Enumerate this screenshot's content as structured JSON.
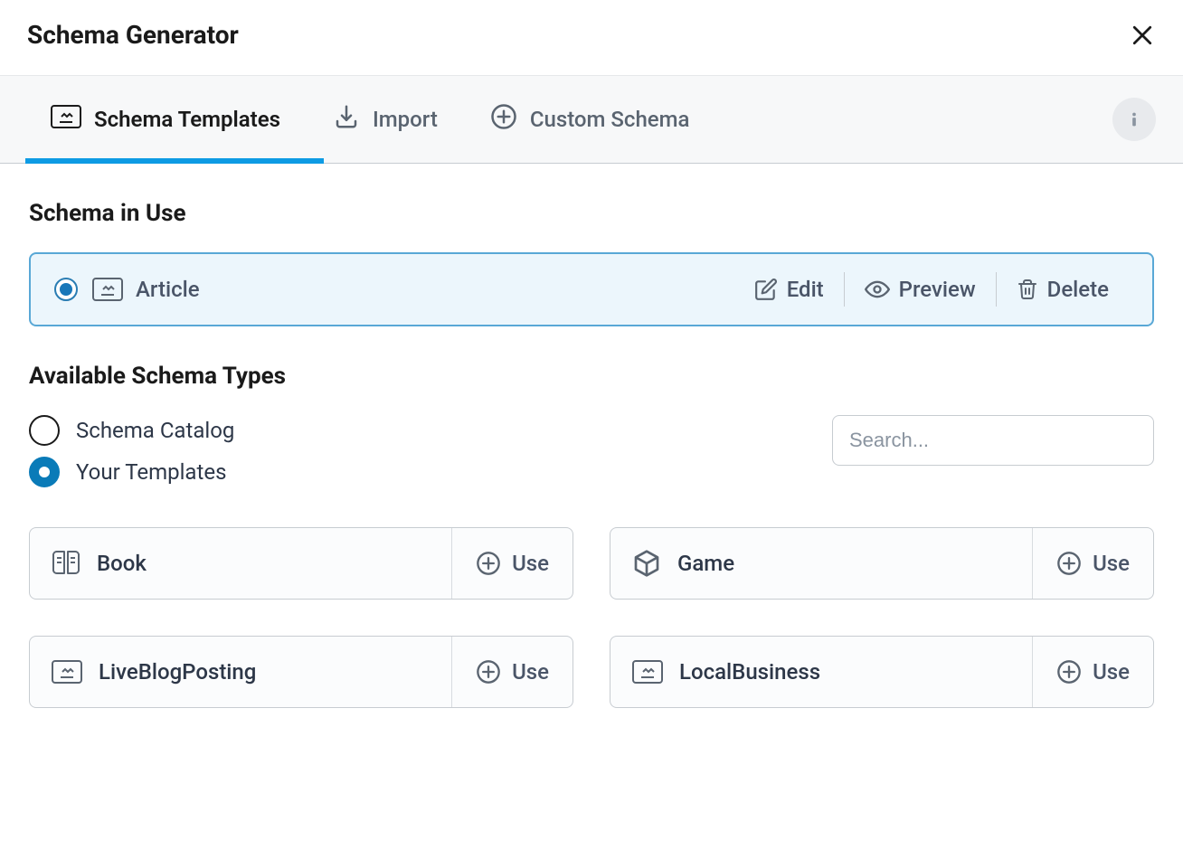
{
  "header": {
    "title": "Schema Generator"
  },
  "tabs": {
    "templates": "Schema Templates",
    "import": "Import",
    "custom": "Custom Schema"
  },
  "sections": {
    "in_use_title": "Schema in Use",
    "available_title": "Available Schema Types"
  },
  "in_use": {
    "name": "Article",
    "actions": {
      "edit": "Edit",
      "preview": "Preview",
      "delete": "Delete"
    }
  },
  "filters": {
    "catalog": "Schema Catalog",
    "templates": "Your Templates"
  },
  "search": {
    "placeholder": "Search..."
  },
  "use_label": "Use",
  "cards": [
    {
      "name": "Book",
      "icon": "book"
    },
    {
      "name": "Game",
      "icon": "box"
    },
    {
      "name": "LiveBlogPosting",
      "icon": "ticket"
    },
    {
      "name": "LocalBusiness",
      "icon": "ticket"
    }
  ]
}
